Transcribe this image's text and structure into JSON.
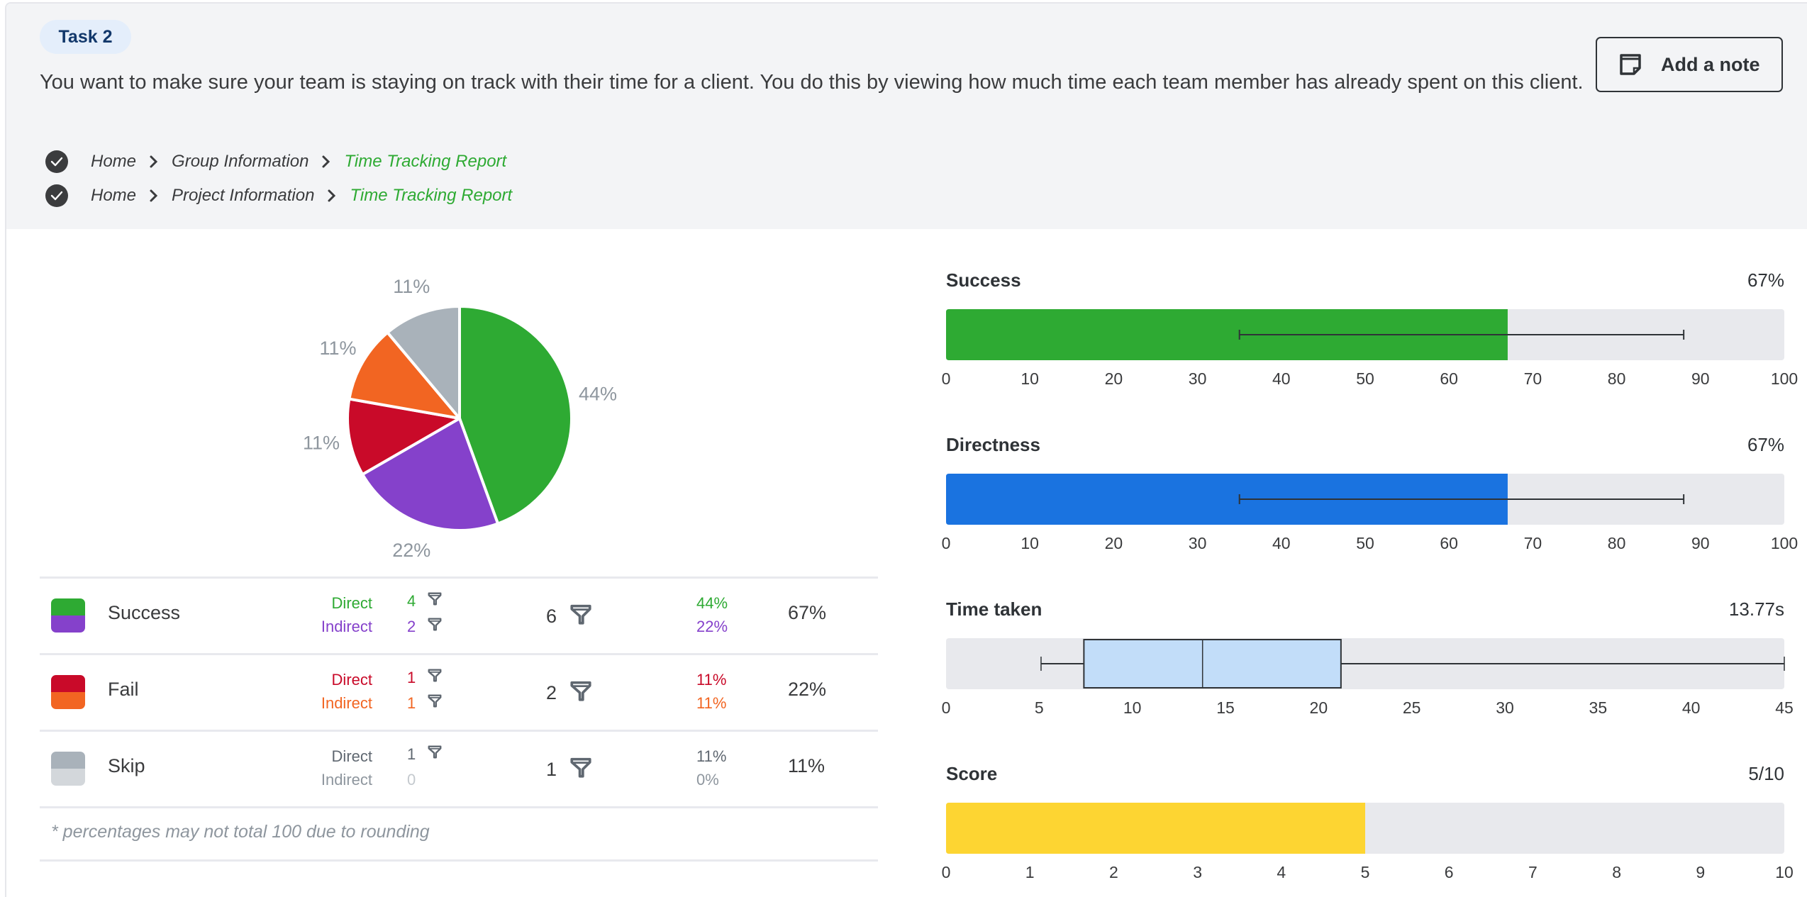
{
  "header": {
    "task_label": "Task 2",
    "task_text": "You want to make sure your team is staying on track with their time for a client. You do this by viewing how much time each team member has already spent on this client.",
    "add_note_label": "Add a note",
    "add_note_icon": "sticky-note-icon",
    "breadcrumbs": [
      {
        "status_icon": "check-circle-icon",
        "items": [
          "Home",
          "Group Information",
          "Time Tracking Report"
        ]
      },
      {
        "status_icon": "check-circle-icon",
        "items": [
          "Home",
          "Project Information",
          "Time Tracking Report"
        ]
      }
    ]
  },
  "colors": {
    "success_direct": "#2eaa33",
    "success_indirect": "#8541cb",
    "fail_direct": "#c90a29",
    "fail_indirect": "#f26522",
    "skip_direct": "#a9b2ba",
    "skip_indirect": "#d3d7db",
    "directness_bar": "#1a73e0",
    "score_bar": "#fdd532",
    "box_fill": "#c2ddf9",
    "track": "#e8e9ed",
    "pie_label": "#8e969e"
  },
  "outcomes": {
    "rows": [
      {
        "name": "Success",
        "direct_label": "Direct",
        "indirect_label": "Indirect",
        "direct_count": "4",
        "indirect_count": "2",
        "total": "6",
        "direct_pct": "44%",
        "indirect_pct": "22%",
        "pct": "67%",
        "direct_color": "#2eaa33",
        "indirect_color": "#8541cb",
        "direct_label_color": "#2eaa33",
        "indirect_label_color": "#8541cb",
        "indirect_count_filter": true
      },
      {
        "name": "Fail",
        "direct_label": "Direct",
        "indirect_label": "Indirect",
        "direct_count": "1",
        "indirect_count": "1",
        "total": "2",
        "direct_pct": "11%",
        "indirect_pct": "11%",
        "pct": "22%",
        "direct_color": "#c90a29",
        "indirect_color": "#f26522",
        "direct_label_color": "#c90a29",
        "indirect_label_color": "#f26522",
        "indirect_count_filter": true
      },
      {
        "name": "Skip",
        "direct_label": "Direct",
        "indirect_label": "Indirect",
        "direct_count": "1",
        "indirect_count": "0",
        "total": "1",
        "direct_pct": "11%",
        "indirect_pct": "0%",
        "pct": "11%",
        "direct_color": "#a9b2ba",
        "indirect_color": "#d3d7db",
        "direct_label_color": "#5f6770",
        "indirect_label_color": "#8e969e",
        "indirect_count_filter": false
      }
    ],
    "footnote": "* percentages may not total 100 due to rounding"
  },
  "chart_data": [
    {
      "type": "pie",
      "title": "",
      "categories": [
        "Success Direct",
        "Success Indirect",
        "Fail Direct",
        "Fail Indirect",
        "Skip Direct"
      ],
      "values": [
        44,
        22,
        11,
        11,
        11
      ],
      "labels": [
        "44%",
        "22%",
        "11%",
        "11%",
        "11%"
      ],
      "colors": [
        "#2eaa33",
        "#8541cb",
        "#c90a29",
        "#f26522",
        "#a9b2ba"
      ]
    },
    {
      "type": "bar",
      "title": "Success",
      "value_label": "67%",
      "value": 67,
      "error_range": [
        35,
        88
      ],
      "xlim": [
        0,
        100
      ],
      "ticks": [
        0,
        10,
        20,
        30,
        40,
        50,
        60,
        70,
        80,
        90,
        100
      ],
      "color": "#2eaa33"
    },
    {
      "type": "bar",
      "title": "Directness",
      "value_label": "67%",
      "value": 67,
      "error_range": [
        35,
        88
      ],
      "xlim": [
        0,
        100
      ],
      "ticks": [
        0,
        10,
        20,
        30,
        40,
        50,
        60,
        70,
        80,
        90,
        100
      ],
      "color": "#1a73e0"
    },
    {
      "type": "boxplot",
      "title": "Time taken",
      "value_label": "13.77s",
      "min": 5.1,
      "q1": 7.4,
      "median": 13.77,
      "q3": 21.2,
      "max": 45,
      "xlim": [
        0,
        45
      ],
      "ticks": [
        0,
        5,
        10,
        15,
        20,
        25,
        30,
        35,
        40,
        45
      ],
      "color": "#c2ddf9"
    },
    {
      "type": "bar",
      "title": "Score",
      "value_label": "5/10",
      "value": 5,
      "xlim": [
        0,
        10
      ],
      "ticks": [
        0,
        1,
        2,
        3,
        4,
        5,
        6,
        7,
        8,
        9,
        10
      ],
      "color": "#fdd532"
    }
  ]
}
